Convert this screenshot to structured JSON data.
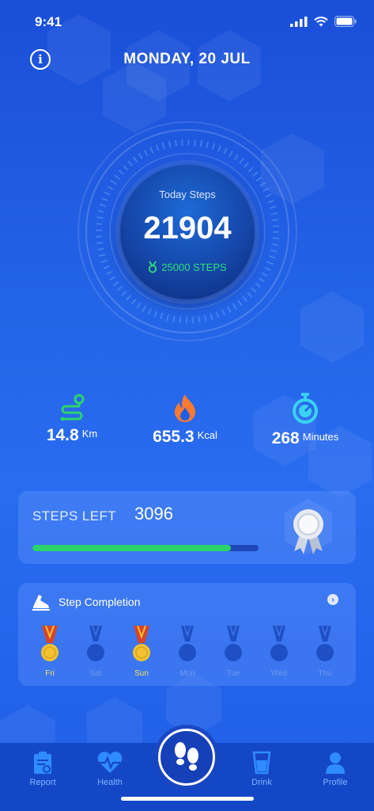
{
  "status": {
    "time": "9:41"
  },
  "header": {
    "date": "MONDAY, 20 JUL",
    "info_icon": "info-icon"
  },
  "dial": {
    "label": "Today Steps",
    "value": "21904",
    "goal": "25000 STEPS",
    "goal_icon": "medal-icon"
  },
  "stats": {
    "distance": {
      "value": "14.8",
      "unit": "Km",
      "icon": "route-icon"
    },
    "calories": {
      "value": "655.3",
      "unit": "Kcal",
      "icon": "flame-icon"
    },
    "time": {
      "value": "268",
      "unit": "Minutes",
      "icon": "stopwatch-icon"
    }
  },
  "steps_left": {
    "label": "STEPS LEFT",
    "value": "3096",
    "progress_fraction": 0.876
  },
  "completion": {
    "title": "Step Completion",
    "days": [
      {
        "label": "Fri",
        "achieved": true
      },
      {
        "label": "Sat",
        "achieved": false
      },
      {
        "label": "Sun",
        "achieved": true
      },
      {
        "label": "Mon",
        "achieved": false
      },
      {
        "label": "Tue",
        "achieved": false
      },
      {
        "label": "Wed",
        "achieved": false
      },
      {
        "label": "Thu",
        "achieved": false
      }
    ]
  },
  "tabbar": {
    "report": "Report",
    "health": "Health",
    "drink": "Drink",
    "profile": "Profile"
  },
  "colors": {
    "accent_green": "#2bd46a",
    "medal_gold": "#f2c230",
    "tab_inactive": "#7fb3ff"
  }
}
